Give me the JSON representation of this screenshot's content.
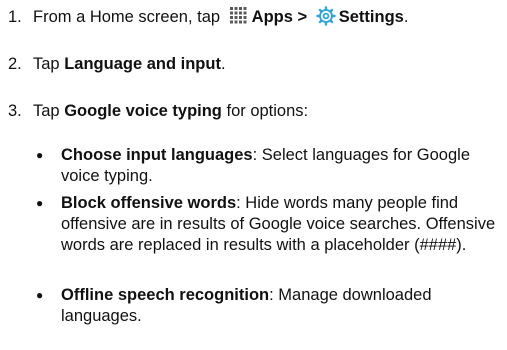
{
  "steps": [
    {
      "num": "1.",
      "pre": "From a Home screen, tap",
      "apps_label": "Apps",
      "separator": ">",
      "settings_label": "Settings",
      "end": "."
    },
    {
      "num": "2.",
      "pre": "Tap",
      "bold": "Language and input",
      "end": "."
    },
    {
      "num": "3.",
      "pre": "Tap",
      "bold": "Google voice typing",
      "end": "for options:"
    }
  ],
  "bullets": [
    {
      "title": "Choose input languages",
      "text": ": Select languages for Google voice typing."
    },
    {
      "title": "Block offensive words",
      "text": ": Hide words many people find offensive are in results of Google voice searches. Offensive words are replaced in results with a placeholder (####)."
    },
    {
      "title": "Offline speech recognition",
      "text": ": Manage downloaded languages."
    }
  ],
  "icons": {
    "apps": "apps-grid-icon",
    "settings": "settings-gear-icon",
    "apps_color": "#5a5a5a",
    "settings_color": "#2aa7d6"
  }
}
